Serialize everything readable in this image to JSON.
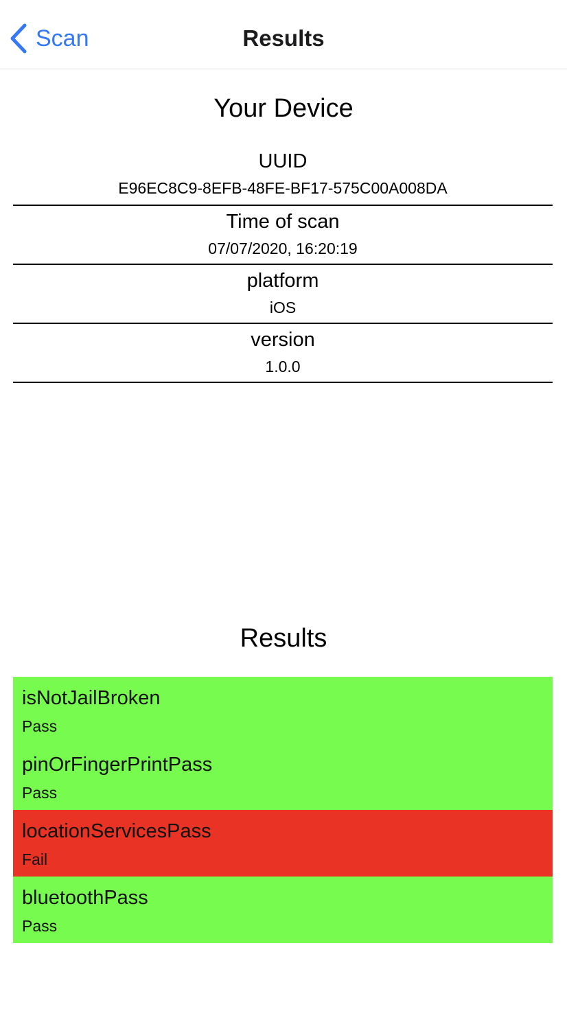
{
  "navbar": {
    "back_label": "Scan",
    "title": "Results"
  },
  "device": {
    "title": "Your Device",
    "fields": [
      {
        "label": "UUID",
        "value": "E96EC8C9-8EFB-48FE-BF17-575C00A008DA"
      },
      {
        "label": "Time of scan",
        "value": "07/07/2020, 16:20:19"
      },
      {
        "label": "platform",
        "value": "iOS"
      },
      {
        "label": "version",
        "value": "1.0.0"
      }
    ]
  },
  "results": {
    "title": "Results",
    "items": [
      {
        "name": "isNotJailBroken",
        "status": "Pass",
        "color": "#77fb4e"
      },
      {
        "name": "pinOrFingerPrintPass",
        "status": "Pass",
        "color": "#77fb4e"
      },
      {
        "name": "locationServicesPass",
        "status": "Fail",
        "color": "#e93425"
      },
      {
        "name": "bluetoothPass",
        "status": "Pass",
        "color": "#77fb4e"
      }
    ]
  },
  "colors": {
    "accent": "#3478f6",
    "pass": "#77fb4e",
    "fail": "#e93425"
  }
}
